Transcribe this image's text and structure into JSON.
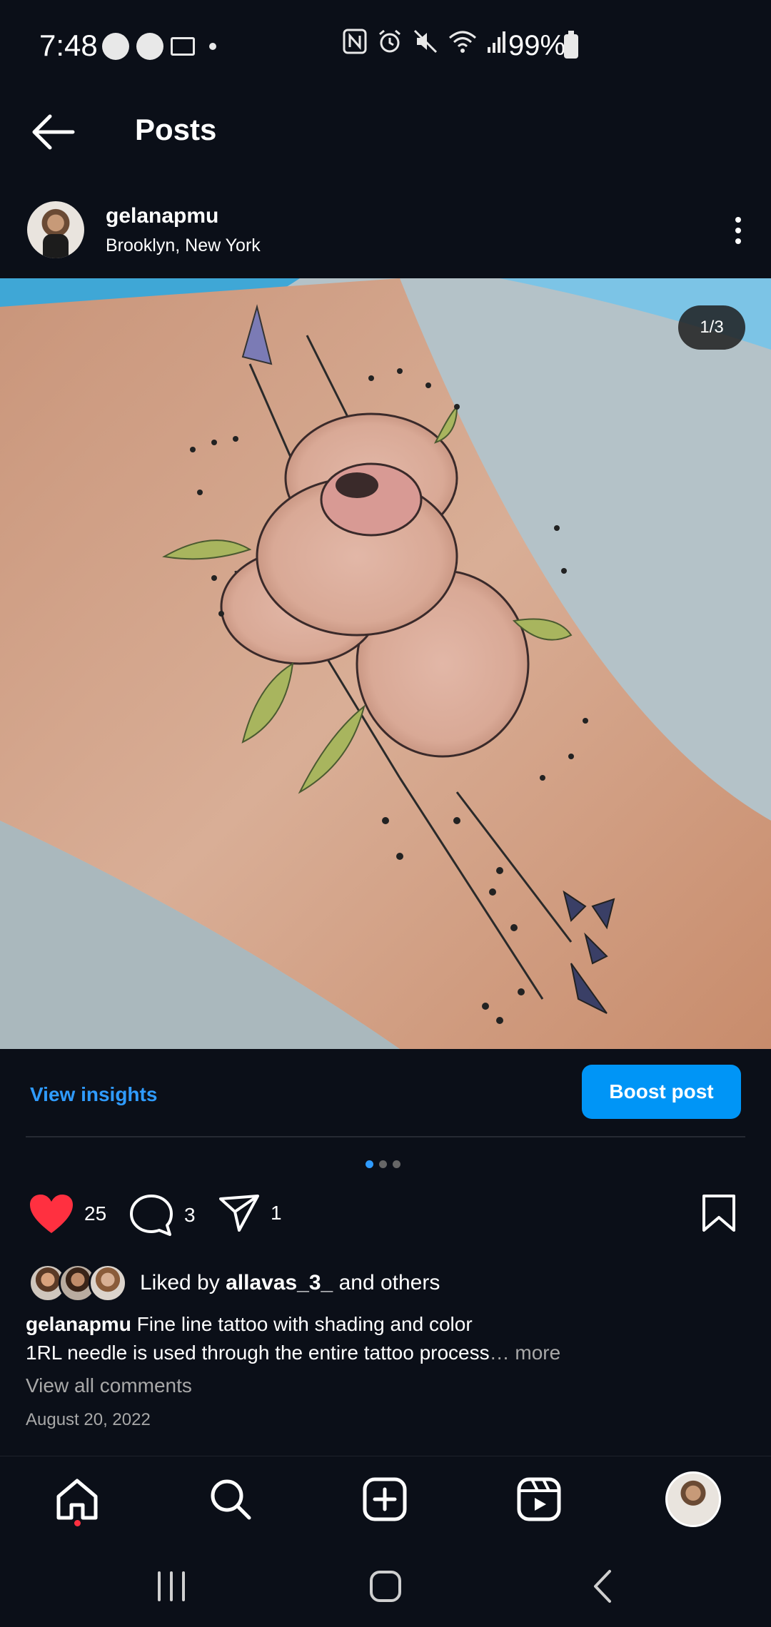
{
  "status_bar": {
    "time": "7:48",
    "battery": "99%"
  },
  "header": {
    "title": "Posts"
  },
  "post": {
    "username": "gelanapmu",
    "location": "Brooklyn, New York",
    "image_counter": "1/3",
    "view_insights": "View insights",
    "boost_label": "Boost post",
    "carousel": {
      "current": 1,
      "total": 3
    },
    "likes": "25",
    "comments": "3",
    "shares": "1",
    "liked_by_prefix": "Liked by",
    "liked_by_user": "allavas_3_",
    "liked_by_suffix": "and others",
    "caption_user": "gelanapmu",
    "caption_line1": "Fine line tattoo with shading and color",
    "caption_line2": "1RL needle is used through the entire tattoo process",
    "caption_more": "… more",
    "view_comments": "View all comments",
    "date": "August 20, 2022"
  },
  "colors": {
    "accent": "#0095f6",
    "link": "#2f9bff",
    "like": "#ff3040",
    "background": "#0b0f18"
  },
  "icons": {
    "like": "heart-icon",
    "comment": "comment-icon",
    "share": "send-icon",
    "save": "bookmark-icon"
  }
}
